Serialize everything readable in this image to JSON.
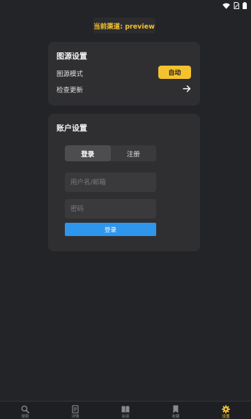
{
  "status_bar": {
    "icons": [
      "wifi-icon",
      "sim-icon",
      "battery-icon"
    ]
  },
  "header": {
    "channel_label": "当前渠道: preview"
  },
  "source_settings": {
    "title": "图源设置",
    "mode_label": "图源模式",
    "mode_button": "自动",
    "check_update_label": "检查更新",
    "check_update_icon": "arrow-right-icon"
  },
  "account_settings": {
    "title": "账户设置",
    "tabs": [
      {
        "label": "登录",
        "active": true
      },
      {
        "label": "注册",
        "active": false
      }
    ],
    "username_placeholder": "用户名/邮箱",
    "password_placeholder": "密码",
    "submit_label": "登录"
  },
  "bottom_nav": {
    "items": [
      {
        "label": "搜索",
        "icon": "search-icon",
        "active": false
      },
      {
        "label": "详情",
        "icon": "document-icon",
        "active": false
      },
      {
        "label": "阅读",
        "icon": "book-icon",
        "active": false
      },
      {
        "label": "收藏",
        "icon": "bookmark-icon",
        "active": false
      },
      {
        "label": "设置",
        "icon": "gear-icon",
        "active": true
      }
    ]
  },
  "colors": {
    "background": "#222427",
    "card": "#2f2f31",
    "accent_yellow": "#f5c22f",
    "accent_blue": "#2f96ed"
  }
}
